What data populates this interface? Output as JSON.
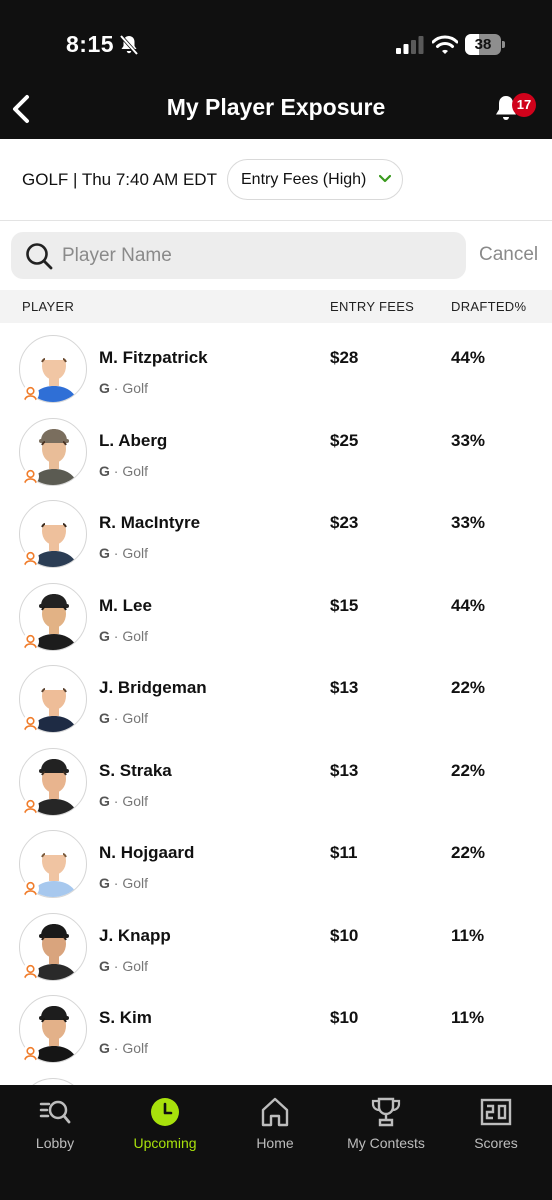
{
  "status_bar": {
    "time": "8:15",
    "battery": "38",
    "battery_level": 0.38
  },
  "header": {
    "title": "My Player Exposure",
    "notification_count": "17"
  },
  "filters": {
    "sport_info": "GOLF | Thu 7:40 AM EDT",
    "sort_label": "Entry Fees (High)"
  },
  "search": {
    "placeholder": "Player Name",
    "value": "",
    "cancel_label": "Cancel"
  },
  "columns": {
    "player": "PLAYER",
    "entry_fees": "ENTRY FEES",
    "drafted": "DRAFTED%"
  },
  "players": [
    {
      "name": "M. Fitzpatrick",
      "pos": "G",
      "sport": "Golf",
      "fee": "$28",
      "pct": "44%"
    },
    {
      "name": "L. Aberg",
      "pos": "G",
      "sport": "Golf",
      "fee": "$25",
      "pct": "33%"
    },
    {
      "name": "R. MacIntyre",
      "pos": "G",
      "sport": "Golf",
      "fee": "$23",
      "pct": "33%"
    },
    {
      "name": "M. Lee",
      "pos": "G",
      "sport": "Golf",
      "fee": "$15",
      "pct": "44%"
    },
    {
      "name": "J. Bridgeman",
      "pos": "G",
      "sport": "Golf",
      "fee": "$13",
      "pct": "22%"
    },
    {
      "name": "S. Straka",
      "pos": "G",
      "sport": "Golf",
      "fee": "$13",
      "pct": "22%"
    },
    {
      "name": "N. Hojgaard",
      "pos": "G",
      "sport": "Golf",
      "fee": "$11",
      "pct": "22%"
    },
    {
      "name": "J. Knapp",
      "pos": "G",
      "sport": "Golf",
      "fee": "$10",
      "pct": "11%"
    },
    {
      "name": "S. Kim",
      "pos": "G",
      "sport": "Golf",
      "fee": "$10",
      "pct": "11%"
    }
  ],
  "tabs": [
    {
      "label": "Lobby",
      "icon": "lobby-search-icon"
    },
    {
      "label": "Upcoming",
      "icon": "clock-icon",
      "active": true
    },
    {
      "label": "Home",
      "icon": "home-icon"
    },
    {
      "label": "My Contests",
      "icon": "trophy-icon"
    },
    {
      "label": "Scores",
      "icon": "scoreboard-icon"
    }
  ],
  "colors": {
    "accent": "#a8e10c",
    "badge": "#d0021b",
    "chevron": "#3a9a1e",
    "user_icon": "#f07c2a",
    "header_bg": "#101010"
  }
}
